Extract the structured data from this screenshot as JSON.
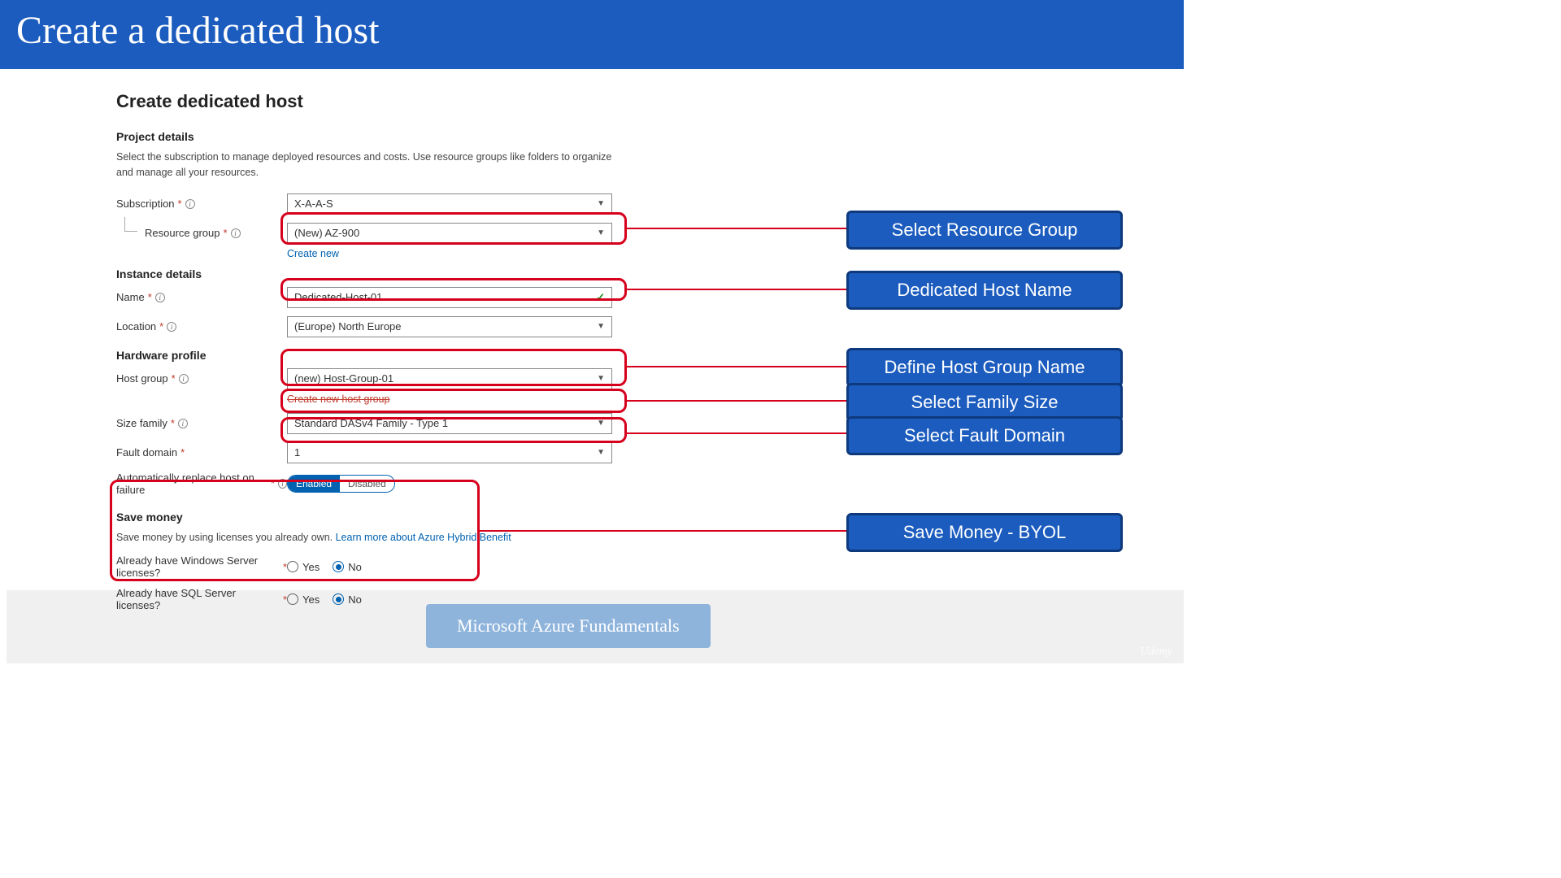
{
  "slide": {
    "title": "Create a dedicated host",
    "footer": "Microsoft Azure Fundamentals",
    "watermark": "Udemy"
  },
  "form": {
    "page_title": "Create dedicated host",
    "project": {
      "section_title": "Project details",
      "description": "Select the subscription to manage deployed resources and costs. Use resource groups like folders to organize and manage all your resources.",
      "subscription_label": "Subscription",
      "subscription_value": "X-A-A-S",
      "resource_group_label": "Resource group",
      "resource_group_value": "(New) AZ-900",
      "create_new": "Create new"
    },
    "instance": {
      "section_title": "Instance details",
      "name_label": "Name",
      "name_value": "Dedicated-Host-01",
      "location_label": "Location",
      "location_value": "(Europe) North Europe"
    },
    "hardware": {
      "section_title": "Hardware profile",
      "host_group_label": "Host group",
      "host_group_value": "(new) Host-Group-01",
      "create_host_group": "Create new host group",
      "size_family_label": "Size family",
      "size_family_value": "Standard DASv4 Family - Type 1",
      "fault_domain_label": "Fault domain",
      "fault_domain_value": "1",
      "auto_replace_label": "Automatically replace host on failure",
      "toggle_enabled": "Enabled",
      "toggle_disabled": "Disabled"
    },
    "save_money": {
      "section_title": "Save money",
      "description_prefix": "Save money by using licenses you already own. ",
      "learn_link": "Learn more about Azure Hybrid Benefit",
      "windows_label": "Already have Windows Server licenses?",
      "sql_label": "Already have SQL Server licenses?",
      "yes": "Yes",
      "no": "No"
    }
  },
  "callouts": {
    "rg": "Select Resource Group",
    "name": "Dedicated Host Name",
    "hg": "Define Host Group Name",
    "size": "Select Family Size",
    "fd": "Select Fault Domain",
    "save": "Save Money - BYOL"
  }
}
